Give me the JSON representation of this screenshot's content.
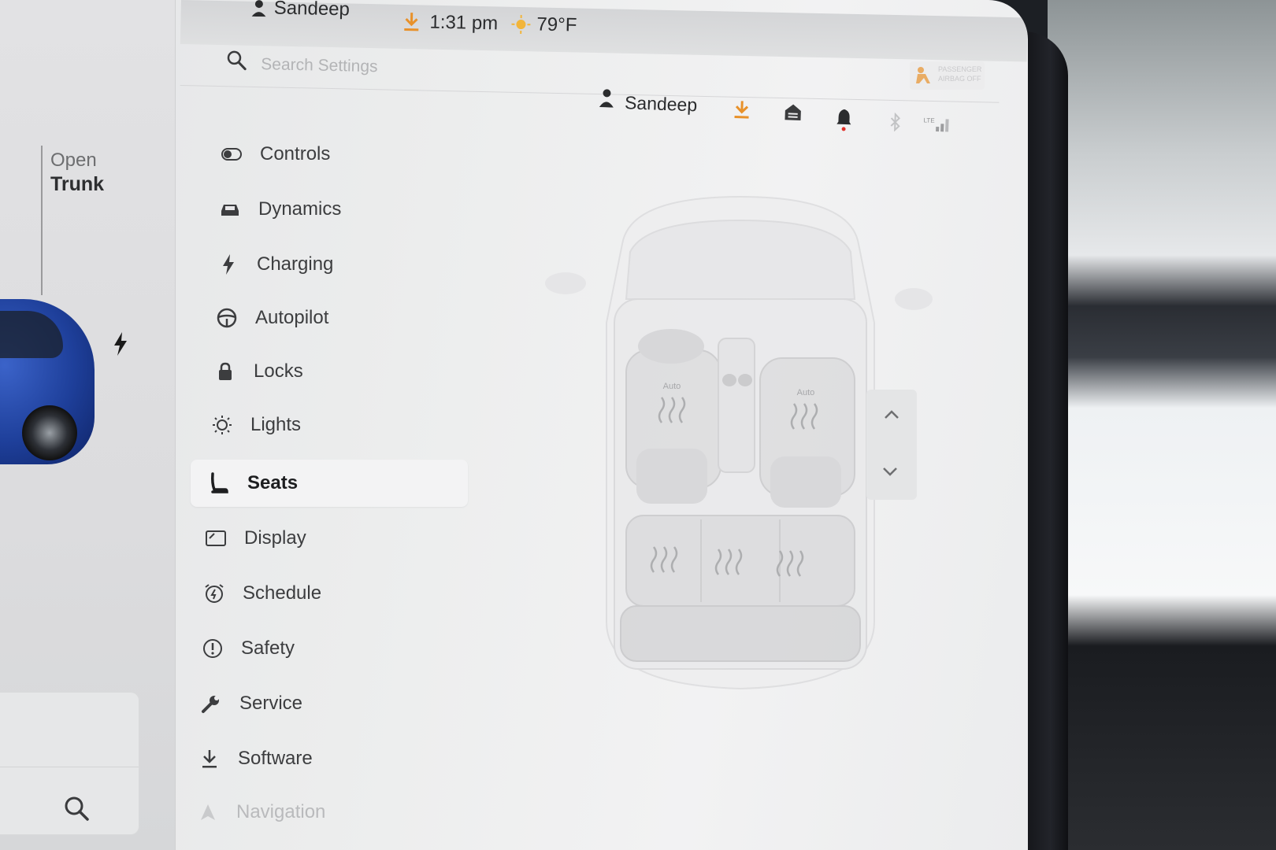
{
  "status_bar": {
    "user_name": "Sandeep",
    "time": "1:31 pm",
    "temperature": "79°F"
  },
  "search": {
    "placeholder": "Search Settings"
  },
  "header": {
    "profile_name": "Sandeep",
    "airbag_badge": "PASSENGER AIRBAG OFF"
  },
  "car_pane": {
    "trunk_open": "Open",
    "trunk_label": "Trunk"
  },
  "menu": {
    "items": [
      {
        "label": "Controls",
        "icon": "toggle-icon"
      },
      {
        "label": "Dynamics",
        "icon": "car-icon"
      },
      {
        "label": "Charging",
        "icon": "bolt-icon"
      },
      {
        "label": "Autopilot",
        "icon": "steering-wheel-icon"
      },
      {
        "label": "Locks",
        "icon": "lock-icon"
      },
      {
        "label": "Lights",
        "icon": "sun-icon"
      },
      {
        "label": "Seats",
        "icon": "seat-icon",
        "active": true
      },
      {
        "label": "Display",
        "icon": "display-icon"
      },
      {
        "label": "Schedule",
        "icon": "alarm-clock-icon"
      },
      {
        "label": "Safety",
        "icon": "exclamation-circle-icon"
      },
      {
        "label": "Service",
        "icon": "wrench-icon"
      },
      {
        "label": "Software",
        "icon": "download-icon"
      },
      {
        "label": "Navigation",
        "icon": "navigation-arrow-icon"
      }
    ]
  },
  "seats": {
    "front_left_label": "Auto",
    "front_right_label": "Auto"
  },
  "colors": {
    "accent_orange": "#e8912a",
    "active_bg": "#f3f3f4",
    "car_blue": "#1e3f9a",
    "notification_red": "#e0312a"
  }
}
